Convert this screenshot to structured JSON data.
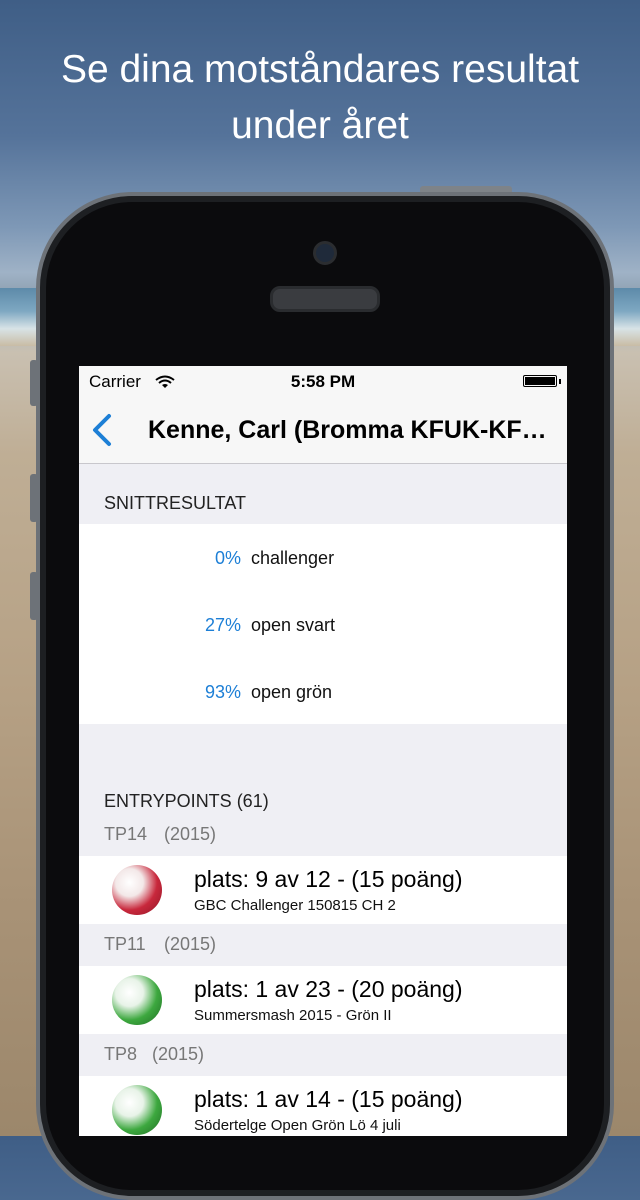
{
  "headline": {
    "line1": "Se dina motståndares resultat",
    "line2": "under året"
  },
  "status_bar": {
    "carrier": "Carrier",
    "time": "5:58 PM"
  },
  "nav": {
    "title": "Kenne, Carl (Bromma KFUK-KFUM)",
    "back_icon": "chevron-left-icon"
  },
  "snittresultat": {
    "header": "SNITTRESULTAT",
    "rows": [
      {
        "percent": "0%",
        "label": "challenger"
      },
      {
        "percent": "27%",
        "label": "open svart"
      },
      {
        "percent": "93%",
        "label": "open grön"
      }
    ]
  },
  "entrypoints": {
    "header": "ENTRYPOINTS (61)",
    "groups": [
      {
        "tp": "TP14",
        "year": "(2015)",
        "ball": "red-volleyball-icon",
        "result": "plats: 9 av 12 - (15 poäng)",
        "event": "GBC Challenger 150815 CH 2"
      },
      {
        "tp": "TP11",
        "year": "(2015)",
        "ball": "green-volleyball-icon",
        "result": "plats: 1 av 23 - (20 poäng)",
        "event": "Summersmash 2015 - Grön II"
      },
      {
        "tp": "TP8",
        "year": "(2015)",
        "ball": "green-volleyball-icon",
        "result": "plats: 1 av 14 - (15 poäng)",
        "event": "Södertelge Open Grön Lö 4 juli"
      }
    ]
  },
  "colors": {
    "accent": "#1d7fd6",
    "background": "#efeff4"
  }
}
